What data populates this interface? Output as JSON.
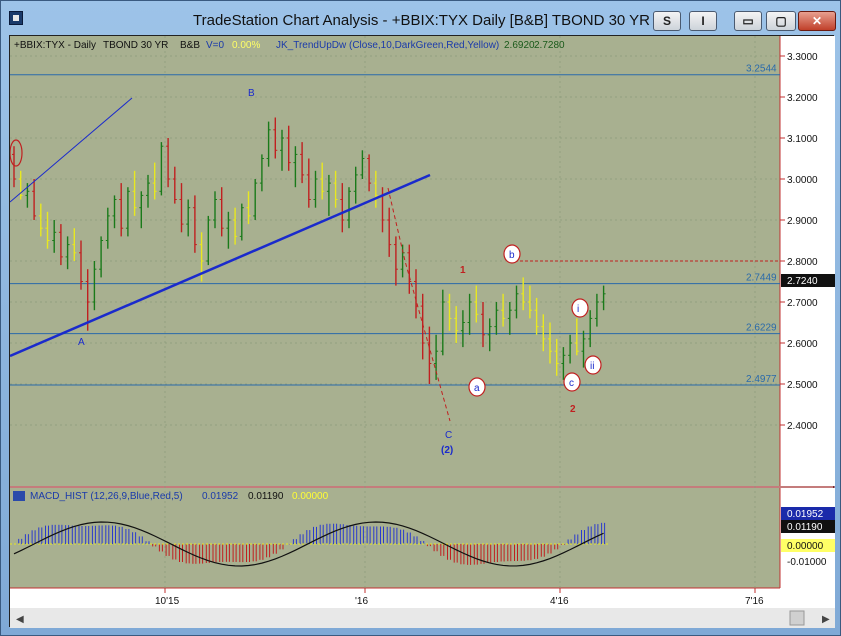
{
  "window": {
    "title": "TradeStation Chart Analysis - +BBIX:TYX Daily [B&B] TBOND 30 YR",
    "btn_s": "S",
    "btn_i": "I",
    "btn_min": "▭",
    "btn_max": "▢",
    "btn_close": "✕"
  },
  "price_panel": {
    "symbol_label": "+BBIX:TYX - Daily",
    "desc_label": "TBOND 30 YR",
    "bb_label": "B&B",
    "volume_label": "V=0",
    "pct_label": "0.00%",
    "indicator_label": "JK_TrendUpDw (Close,10,DarkGreen,Red,Yellow)",
    "indicator_val1": "2.6920",
    "indicator_val2": "2.7280",
    "last_price": "2.7240",
    "y_ticks": [
      "3.3000",
      "3.2000",
      "3.1000",
      "3.0000",
      "2.9000",
      "2.8000",
      "2.7000",
      "2.6000",
      "2.5000",
      "2.4000"
    ],
    "levels": [
      "3.2544",
      "2.7449",
      "2.6229",
      "2.4977"
    ],
    "wave_labels": [
      "B",
      "A",
      "C",
      "(2)",
      "1",
      "2",
      "a",
      "b",
      "c",
      "i",
      "ii"
    ]
  },
  "macd_panel": {
    "label": "MACD_HIST (12,26,9,Blue,Red,5)",
    "val1": "0.01952",
    "val2": "0.01190",
    "val3": "0.00000",
    "y_tick": "-0.01000",
    "badge1": "0.01952",
    "badge2": "0.01190",
    "badge3": "0.00000"
  },
  "x_axis": {
    "ticks": [
      "10'15",
      "'16",
      "4'16",
      "7'16"
    ]
  },
  "chart_data": {
    "type": "ohlc",
    "y_range": [
      2.35,
      3.32
    ],
    "bars": [
      [
        3.06,
        3.08,
        2.98,
        3.0
      ],
      [
        3.0,
        3.02,
        2.95,
        2.96
      ],
      [
        2.96,
        2.99,
        2.93,
        2.97
      ],
      [
        2.97,
        3.0,
        2.9,
        2.91
      ],
      [
        2.91,
        2.94,
        2.86,
        2.88
      ],
      [
        2.88,
        2.92,
        2.83,
        2.85
      ],
      [
        2.85,
        2.9,
        2.82,
        2.87
      ],
      [
        2.87,
        2.89,
        2.79,
        2.81
      ],
      [
        2.81,
        2.86,
        2.78,
        2.84
      ],
      [
        2.84,
        2.88,
        2.8,
        2.82
      ],
      [
        2.82,
        2.85,
        2.73,
        2.75
      ],
      [
        2.75,
        2.78,
        2.63,
        2.7
      ],
      [
        2.7,
        2.8,
        2.68,
        2.78
      ],
      [
        2.78,
        2.86,
        2.76,
        2.85
      ],
      [
        2.85,
        2.93,
        2.83,
        2.91
      ],
      [
        2.91,
        2.96,
        2.88,
        2.95
      ],
      [
        2.95,
        2.99,
        2.86,
        2.88
      ],
      [
        2.88,
        2.98,
        2.86,
        2.97
      ],
      [
        2.97,
        3.02,
        2.91,
        2.93
      ],
      [
        2.93,
        2.97,
        2.88,
        2.96
      ],
      [
        2.96,
        3.01,
        2.93,
        2.99
      ],
      [
        2.99,
        3.04,
        2.95,
        2.97
      ],
      [
        2.97,
        3.09,
        2.96,
        3.08
      ],
      [
        3.08,
        3.1,
        2.98,
        3.0
      ],
      [
        3.0,
        3.03,
        2.94,
        2.95
      ],
      [
        2.95,
        2.99,
        2.87,
        2.89
      ],
      [
        2.89,
        2.95,
        2.86,
        2.93
      ],
      [
        2.93,
        2.96,
        2.82,
        2.84
      ],
      [
        2.84,
        2.87,
        2.75,
        2.8
      ],
      [
        2.8,
        2.91,
        2.79,
        2.9
      ],
      [
        2.9,
        2.97,
        2.88,
        2.95
      ],
      [
        2.95,
        2.98,
        2.86,
        2.88
      ],
      [
        2.88,
        2.92,
        2.83,
        2.9
      ],
      [
        2.9,
        2.93,
        2.84,
        2.86
      ],
      [
        2.86,
        2.94,
        2.85,
        2.93
      ],
      [
        2.93,
        2.97,
        2.89,
        2.91
      ],
      [
        2.91,
        3.0,
        2.9,
        2.99
      ],
      [
        2.99,
        3.06,
        2.97,
        3.05
      ],
      [
        3.05,
        3.14,
        3.03,
        3.12
      ],
      [
        3.12,
        3.15,
        3.05,
        3.07
      ],
      [
        3.07,
        3.12,
        3.02,
        3.1
      ],
      [
        3.1,
        3.13,
        3.02,
        3.04
      ],
      [
        3.04,
        3.08,
        2.98,
        3.06
      ],
      [
        3.06,
        3.09,
        2.99,
        3.01
      ],
      [
        3.01,
        3.05,
        2.93,
        2.95
      ],
      [
        2.95,
        3.02,
        2.93,
        3.0
      ],
      [
        3.0,
        3.04,
        2.95,
        2.97
      ],
      [
        2.97,
        3.01,
        2.91,
        2.99
      ],
      [
        2.99,
        3.02,
        2.93,
        2.95
      ],
      [
        2.95,
        2.99,
        2.87,
        2.9
      ],
      [
        2.9,
        2.98,
        2.88,
        2.97
      ],
      [
        2.97,
        3.03,
        2.94,
        3.01
      ],
      [
        3.01,
        3.07,
        3.0,
        3.05
      ],
      [
        3.05,
        3.06,
        2.97,
        2.99
      ],
      [
        2.99,
        3.02,
        2.93,
        2.96
      ],
      [
        2.96,
        2.98,
        2.87,
        2.9
      ],
      [
        2.9,
        2.93,
        2.81,
        2.84
      ],
      [
        2.84,
        2.86,
        2.74,
        2.78
      ],
      [
        2.78,
        2.84,
        2.76,
        2.82
      ],
      [
        2.82,
        2.84,
        2.72,
        2.75
      ],
      [
        2.75,
        2.78,
        2.66,
        2.69
      ],
      [
        2.69,
        2.72,
        2.56,
        2.6
      ],
      [
        2.6,
        2.64,
        2.5,
        2.55
      ],
      [
        2.55,
        2.62,
        2.51,
        2.58
      ],
      [
        2.58,
        2.73,
        2.57,
        2.7
      ],
      [
        2.7,
        2.72,
        2.63,
        2.66
      ],
      [
        2.66,
        2.69,
        2.6,
        2.63
      ],
      [
        2.63,
        2.68,
        2.59,
        2.65
      ],
      [
        2.65,
        2.72,
        2.62,
        2.7
      ],
      [
        2.7,
        2.74,
        2.65,
        2.67
      ],
      [
        2.67,
        2.7,
        2.59,
        2.62
      ],
      [
        2.62,
        2.66,
        2.58,
        2.64
      ],
      [
        2.64,
        2.7,
        2.62,
        2.68
      ],
      [
        2.68,
        2.72,
        2.64,
        2.66
      ],
      [
        2.66,
        2.7,
        2.62,
        2.68
      ],
      [
        2.68,
        2.74,
        2.66,
        2.72
      ],
      [
        2.72,
        2.76,
        2.68,
        2.7
      ],
      [
        2.7,
        2.74,
        2.66,
        2.68
      ],
      [
        2.68,
        2.71,
        2.62,
        2.64
      ],
      [
        2.64,
        2.67,
        2.58,
        2.61
      ],
      [
        2.61,
        2.65,
        2.55,
        2.58
      ],
      [
        2.58,
        2.61,
        2.52,
        2.55
      ],
      [
        2.55,
        2.59,
        2.51,
        2.57
      ],
      [
        2.57,
        2.62,
        2.55,
        2.6
      ],
      [
        2.6,
        2.66,
        2.57,
        2.58
      ],
      [
        2.58,
        2.63,
        2.54,
        2.61
      ],
      [
        2.61,
        2.68,
        2.59,
        2.66
      ],
      [
        2.66,
        2.72,
        2.64,
        2.7
      ],
      [
        2.7,
        2.74,
        2.68,
        2.72
      ]
    ],
    "trendline_points": [
      [
        0,
        2.55
      ],
      [
        88,
        2.98
      ]
    ]
  }
}
